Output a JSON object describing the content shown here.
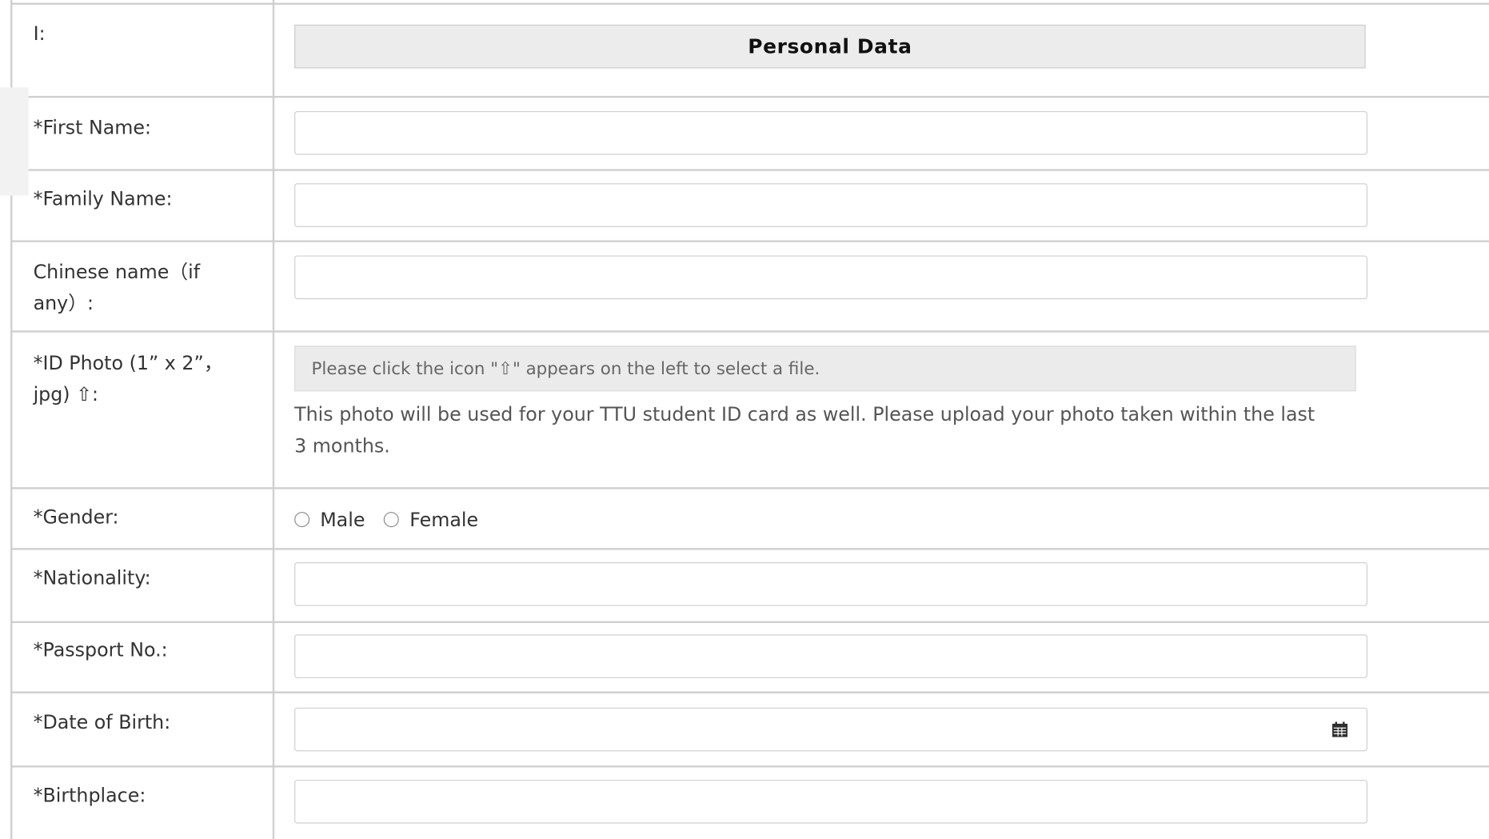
{
  "section": {
    "number_label": "I:",
    "title": "Personal Data"
  },
  "fields": {
    "first_name": {
      "label": "*First Name:",
      "value": ""
    },
    "family_name": {
      "label": "*Family Name:",
      "value": ""
    },
    "chinese_name": {
      "label_line1": "Chinese name（if",
      "label_line2": "any）:",
      "value": ""
    },
    "id_photo": {
      "label_line1": "*ID Photo (1” x 2”，",
      "label_line2": "jpg) ⇧:",
      "file_placeholder": "Please click the icon \"⇧\" appears on the left to select a file.",
      "note_line1": "This photo will be used for your TTU student ID card as well. Please upload your photo taken within the last",
      "note_line2": "3 months."
    },
    "gender": {
      "label": "*Gender:",
      "options": [
        "Male",
        "Female"
      ],
      "selected": null
    },
    "nationality": {
      "label": "*Nationality:",
      "value": ""
    },
    "passport_no": {
      "label": "*Passport No.:",
      "value": ""
    },
    "date_of_birth": {
      "label": "*Date of Birth:",
      "value": "",
      "icon": "calendar-icon"
    },
    "birthplace": {
      "label": "*Birthplace:",
      "value": ""
    }
  }
}
